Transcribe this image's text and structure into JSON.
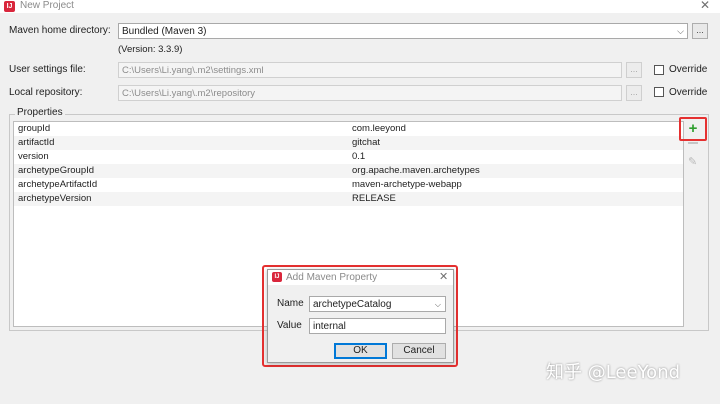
{
  "window": {
    "title": "New Project",
    "icon": "intellij-icon",
    "close_glyph": "✕"
  },
  "maven": {
    "home_label": "Maven home directory:",
    "home_value": "Bundled (Maven 3)",
    "version": "(Version: 3.3.9)",
    "settings_label": "User settings file:",
    "settings_value": "C:\\Users\\Li.yang\\.m2\\settings.xml",
    "repo_label": "Local repository:",
    "repo_value": "C:\\Users\\Li.yang\\.m2\\repository",
    "override_label": "Override",
    "browse_label": "..."
  },
  "properties": {
    "legend": "Properties",
    "rows": [
      {
        "key": "groupId",
        "value": "com.leeyond"
      },
      {
        "key": "artifactId",
        "value": "gitchat"
      },
      {
        "key": "version",
        "value": "0.1"
      },
      {
        "key": "archetypeGroupId",
        "value": "org.apache.maven.archetypes"
      },
      {
        "key": "archetypeArtifactId",
        "value": "maven-archetype-webapp"
      },
      {
        "key": "archetypeVersion",
        "value": "RELEASE"
      }
    ],
    "add_glyph": "+",
    "edit_glyph": "✎"
  },
  "dialog": {
    "title": "Add Maven Property",
    "close_glyph": "✕",
    "name_label": "Name",
    "name_value": "archetypeCatalog",
    "value_label": "Value",
    "value_value": "internal",
    "ok_label": "OK",
    "cancel_label": "Cancel"
  },
  "watermark": "知乎 @LeeYond",
  "colors": {
    "highlight": "#e53030",
    "add_green": "#2e9e2e",
    "default_button": "#0078d7"
  }
}
